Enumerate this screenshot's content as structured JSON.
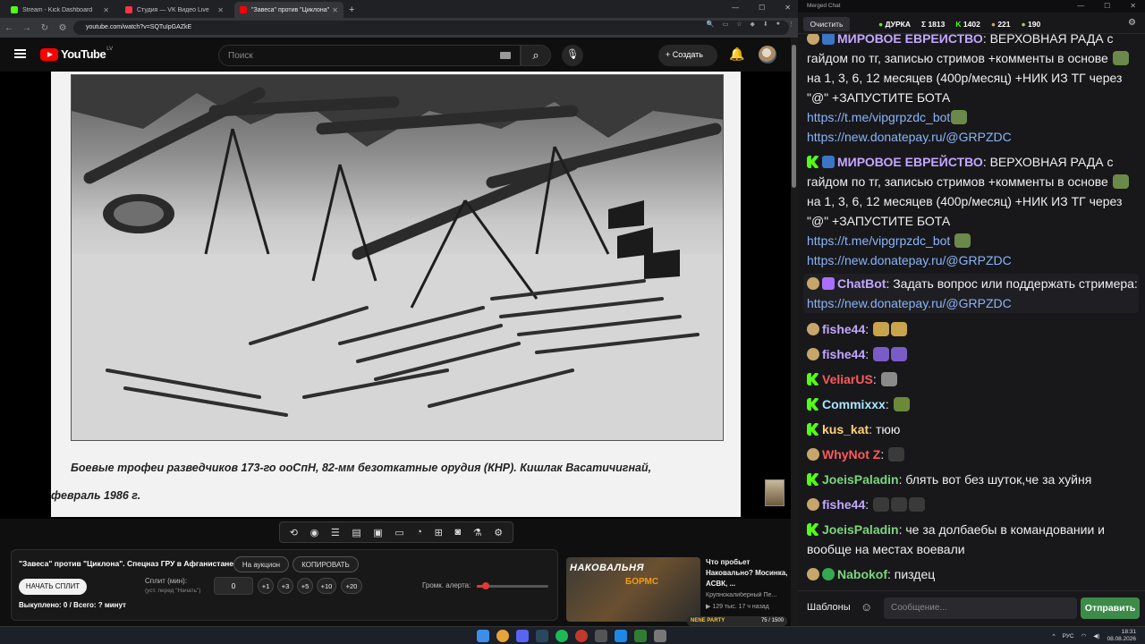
{
  "browser": {
    "tabs": [
      {
        "label": "Stream - Kick Dashboard",
        "color": "#53fc18",
        "active": false
      },
      {
        "label": "Студия — VK Видео Live",
        "color": "#ff3347",
        "active": false
      },
      {
        "label": "\"Завеса\" против \"Циклона\"",
        "color": "#ff0000",
        "active": true
      }
    ],
    "new_tab": "+",
    "url": "youtube.com/watch?v=SQTuIpGAZkE"
  },
  "youtube": {
    "logo_text": "YouTube",
    "country_code": "LV",
    "search_placeholder": "Поиск",
    "create_label": "Создать"
  },
  "slide": {
    "caption_line1": "Боевые трофеи разведчиков 173-го ооСпН, 82-мм безоткатные орудия (КНР). Кишлак Васатичигнай,",
    "caption_line2": "февраль 1986 г."
  },
  "panel": {
    "title": "\"Завеса\" против \"Циклона\". Спецназ ГРУ в Афганистане.",
    "auction_label": "На аукцион",
    "copy_label": "КОПИРОВАТЬ",
    "start_label": "НАЧАТЬ СПЛИТ",
    "split_label": "Сплит (мин):",
    "split_hint": "(уст. перед \"Начать\")",
    "split_value": "0",
    "increments": [
      "+1",
      "+3",
      "+5",
      "+10",
      "+20"
    ],
    "volume_label": "Громк. алерта:",
    "volume_level": 0.12,
    "bought_text": "Выкуплено: 0 / Всего: ? минут"
  },
  "recommendation": {
    "thumb_text": "НАКОВАЛЬНЯ",
    "thumb_text2": "БОРМС",
    "title": "Что пробьет Наковально? Мосинка, АСВК, ...",
    "channel": "Крупнокалиберный Пе...",
    "meta": "▶ 129 тыс.   17 ч назад",
    "nene_label": "NENE PARTY",
    "nene_progress": "75 / 1500"
  },
  "chat": {
    "window_title": "Merged Chat",
    "clear_label": "Очистить",
    "stats": [
      {
        "icon": "●",
        "value": "ДУРКА",
        "color": "#53fc18"
      },
      {
        "icon": "Σ",
        "value": "1813",
        "color": "#ffffff"
      },
      {
        "icon": "K",
        "value": "1402",
        "color": "#53fc18"
      },
      {
        "icon": "●",
        "value": "221",
        "color": "#c6a66a"
      },
      {
        "icon": "●",
        "value": "190",
        "color": "#9bd36a"
      }
    ],
    "messages": [
      {
        "name": "МИРОВОЕ ЕВРЕЙСТВО",
        "color": "#c3a6ff",
        "text": "ВЕРХОВНАЯ РАДА с гайдом по тг, записью стримов +комменты в основе",
        "text2": "на 1, 3, 6, 12 месяцев (400р/месяц) +НИК ИЗ ТГ через \"@\" +ЗАПУСТИТЕ БОТА",
        "link1": "https://t.me/vipgrpzdc_bot",
        "link2": "https://new.donatepay.ru/@GRPZDC"
      },
      {
        "name": "МИРОВОЕ ЕВРЕЙСТВО",
        "color": "#c3a6ff",
        "text": "ВЕРХОВНАЯ РАДА с гайдом по тг, записью стримов +комменты в основе",
        "text2": "на 1, 3, 6, 12 месяцев (400р/месяц) +НИК ИЗ ТГ через \"@\" +ЗАПУСТИТЕ БОТА",
        "link1": "https://t.me/vipgrpzdc_bot",
        "link2": "https://new.donatepay.ru/@GRPZDC"
      },
      {
        "name": "ChatBot",
        "color": "#c3a6ff",
        "text": "Задать вопрос или поддержать стримера:",
        "link1": "https://new.donatepay.ru/@GRPZDC"
      },
      {
        "name": "fishe44",
        "color": "#c3a6ff",
        "text": ""
      },
      {
        "name": "fishe44",
        "color": "#c3a6ff",
        "text": ""
      },
      {
        "name": "VeliarUS",
        "color": "#ff5a5a",
        "text": ""
      },
      {
        "name": "Commixxx",
        "color": "#a8e6ff",
        "text": ""
      },
      {
        "name": "kus_kat",
        "color": "#ffd27a",
        "text": "тюю"
      },
      {
        "name": "WhyNot Z",
        "color": "#ff5a5a",
        "text": ""
      },
      {
        "name": "JoeisPaladin",
        "color": "#7cd67c",
        "text": "блять вот без шуток,че за хуйня"
      },
      {
        "name": "fishe44",
        "color": "#c3a6ff",
        "text": ""
      },
      {
        "name": "JoeisPaladin",
        "color": "#7cd67c",
        "text": "че за долбаебы в командовании и вообще на местах воевали"
      },
      {
        "name": "Nabokof",
        "color": "#7cd67c",
        "text": "пиздец"
      }
    ],
    "templates_label": "Шаблоны",
    "input_placeholder": "Сообщение...",
    "send_label": "Отправить"
  },
  "taskbar": {
    "lang": "РУС",
    "time": "18:31",
    "date": "08.08.2026"
  }
}
